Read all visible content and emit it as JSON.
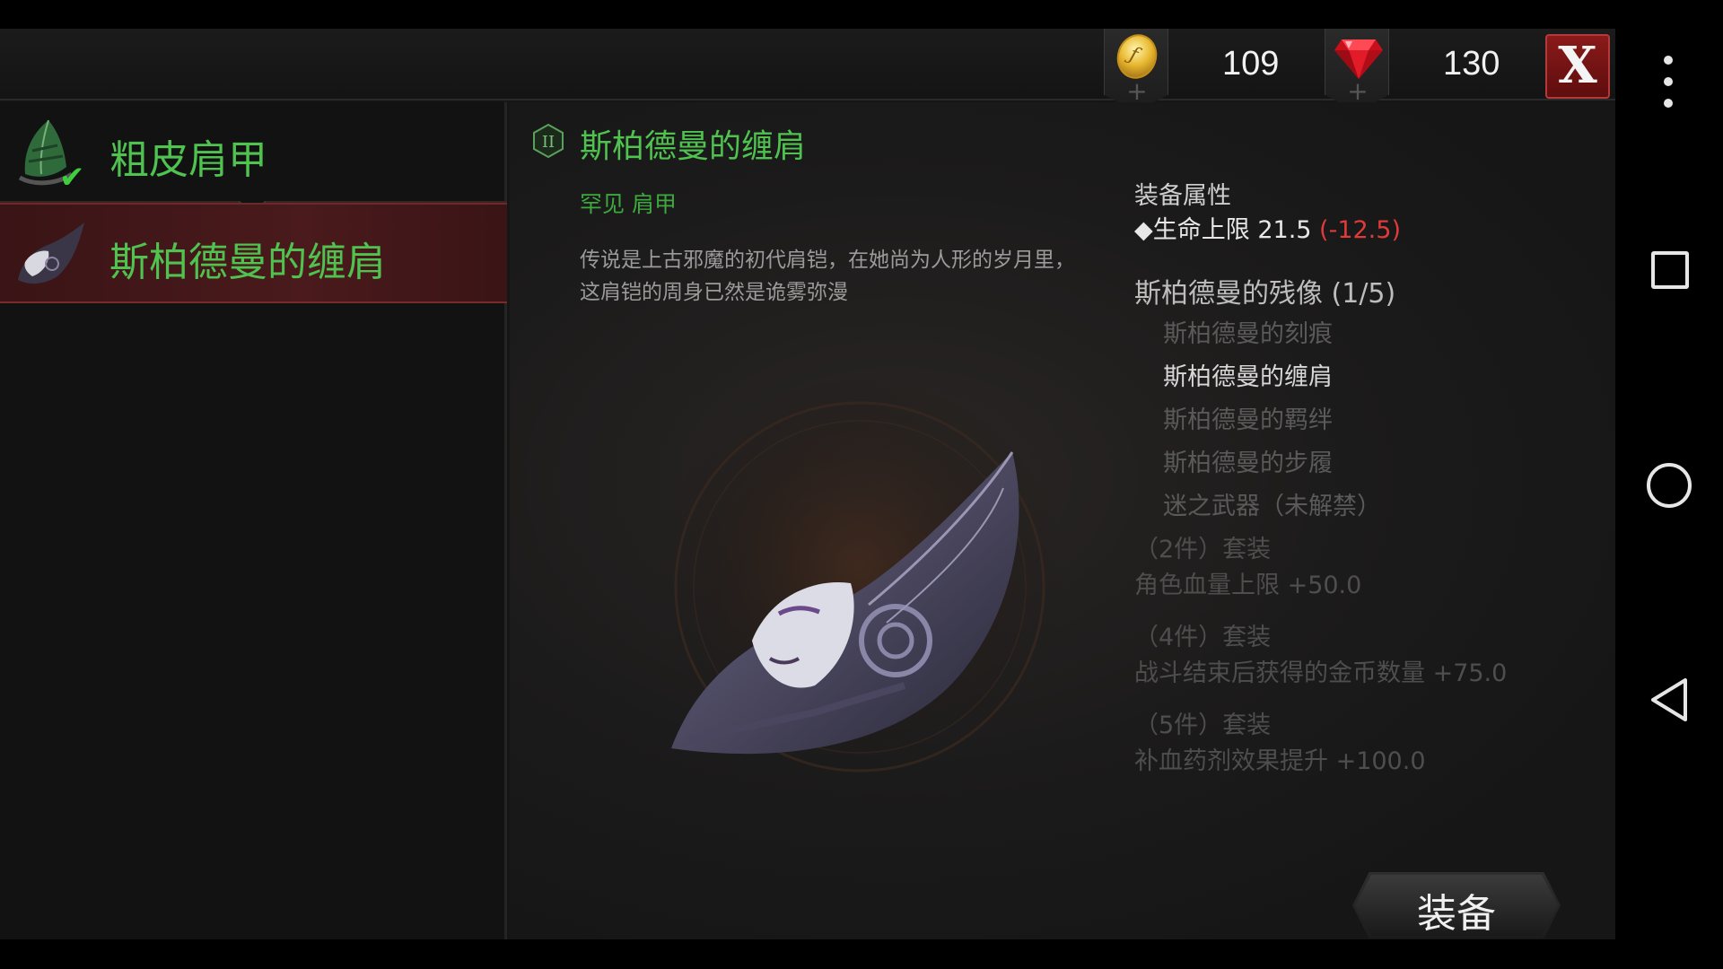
{
  "topbar": {
    "gold": {
      "icon": "gold-coin-icon",
      "value": "109",
      "plus": "+"
    },
    "gems": {
      "icon": "ruby-gem-icon",
      "value": "130",
      "plus": "+"
    },
    "close_label": "X"
  },
  "item_list": {
    "items": [
      {
        "name": "粗皮肩甲",
        "icon": "leaf-shoulder-armor-icon",
        "equipped": true,
        "check_icon": "✔"
      },
      {
        "name": "斯柏德曼的缠肩",
        "icon": "mask-shoulder-armor-icon",
        "selected": true
      }
    ]
  },
  "detail": {
    "rank_badge": "II",
    "name": "斯柏德曼的缠肩",
    "rarity": "罕见 肩甲",
    "description": "传说是上古邪魔的初代肩铠，在她尚为人形的岁月里，这肩铠的周身已然是诡雾弥漫",
    "attributes": {
      "title": "装备属性",
      "line": "◆生命上限 21.5 ",
      "diff": "(-12.5)"
    },
    "set": {
      "title": "斯柏德曼的残像 (1/5)",
      "pieces": [
        {
          "name": "斯柏德曼的刻痕",
          "owned": false
        },
        {
          "name": "斯柏德曼的缠肩",
          "owned": true
        },
        {
          "name": "斯柏德曼的羁绊",
          "owned": false
        },
        {
          "name": "斯柏德曼的步履",
          "owned": false
        },
        {
          "name": "迷之武器（未解禁）",
          "owned": false
        }
      ],
      "bonuses": [
        {
          "head": "（2件）套装",
          "text": "角色血量上限 +50.0"
        },
        {
          "head": "（4件）套装",
          "text": "战斗结束后获得的金币数量 +75.0"
        },
        {
          "head": "（5件）套装",
          "text": "补血药剂效果提升 +100.0"
        }
      ]
    },
    "equip_label": "装备"
  },
  "colors": {
    "item_green": "#4fc24f",
    "selected_row": "#4a1a1c",
    "stat_decrease": "#e03a3a",
    "close_red": "#8a1a1a"
  },
  "android_nav": {
    "menu": "overflow-menu-icon",
    "recents": "recents-square-icon",
    "home": "home-circle-icon",
    "back": "back-triangle-icon"
  }
}
